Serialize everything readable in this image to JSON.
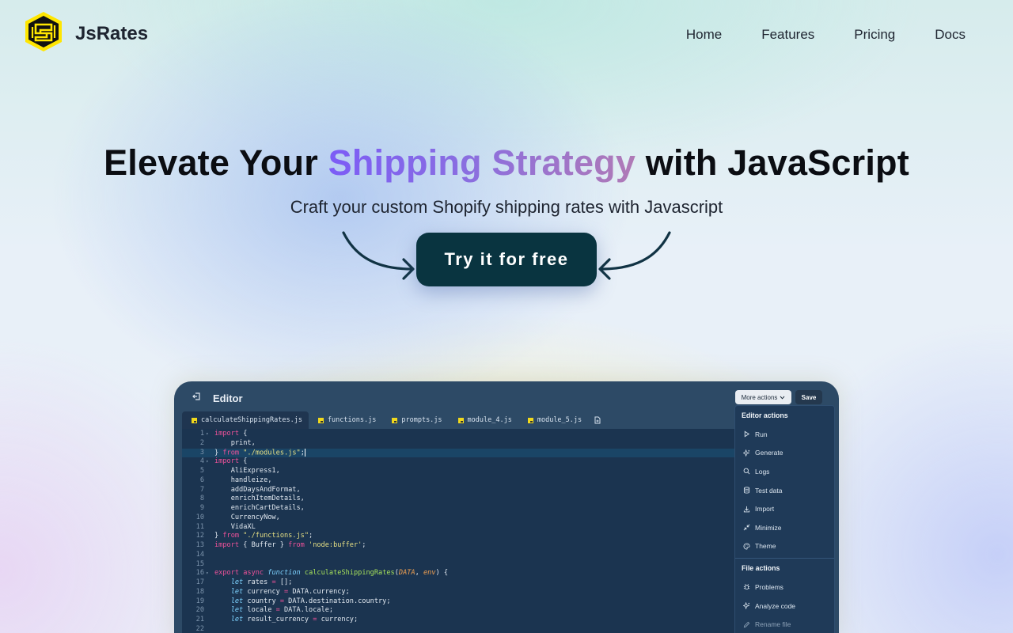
{
  "header": {
    "brand": "JsRates",
    "nav": [
      "Home",
      "Features",
      "Pricing",
      "Docs"
    ]
  },
  "hero": {
    "title_before": "Elevate Your ",
    "title_highlight": "Shipping Strategy",
    "title_after": " with JavaScript",
    "subtitle": "Craft your custom Shopify shipping rates with Javascript",
    "cta_label": "Try it for free"
  },
  "editor": {
    "title": "Editor",
    "more_actions_label": "More actions",
    "save_label": "Save",
    "tabs": [
      "calculateShippingRates.js",
      "functions.js",
      "prompts.js",
      "module_4.js",
      "module_5.js"
    ],
    "active_tab": "calculateShippingRates.js",
    "code_lines": [
      "import {",
      "    print,",
      "} from \"./modules.js\";",
      "import {",
      "    AliExpress1,",
      "    handleize,",
      "    addDaysAndFormat,",
      "    enrichItemDetails,",
      "    enrichCartDetails,",
      "    CurrencyNow,",
      "    VidaXL",
      "} from \"./functions.js\";",
      "import { Buffer } from 'node:buffer';",
      "",
      "",
      "export async function calculateShippingRates(DATA, env) {",
      "    let rates = [];",
      "    let currency = DATA.currency;",
      "    let country = DATA.destination.country;",
      "    let locale = DATA.locale;",
      "    let result_currency = currency;",
      ""
    ],
    "menu": {
      "editor_actions_title": "Editor actions",
      "editor_actions": [
        {
          "label": "Run",
          "icon": "play-icon"
        },
        {
          "label": "Generate",
          "icon": "sparkles-icon"
        },
        {
          "label": "Logs",
          "icon": "search-icon"
        },
        {
          "label": "Test data",
          "icon": "database-icon"
        },
        {
          "label": "Import",
          "icon": "download-icon"
        },
        {
          "label": "Minimize",
          "icon": "minimize-icon"
        },
        {
          "label": "Theme",
          "icon": "palette-icon"
        }
      ],
      "file_actions_title": "File actions",
      "file_actions": [
        {
          "label": "Problems",
          "icon": "bug-icon"
        },
        {
          "label": "Analyze code",
          "icon": "sparkles-icon"
        },
        {
          "label": "Rename file",
          "icon": "pencil-icon"
        }
      ]
    }
  },
  "colors": {
    "cta_bg": "#093440",
    "logo_yellow": "#ffe600",
    "editor_bg": "#2d4a66",
    "code_bg": "#1b3450"
  }
}
